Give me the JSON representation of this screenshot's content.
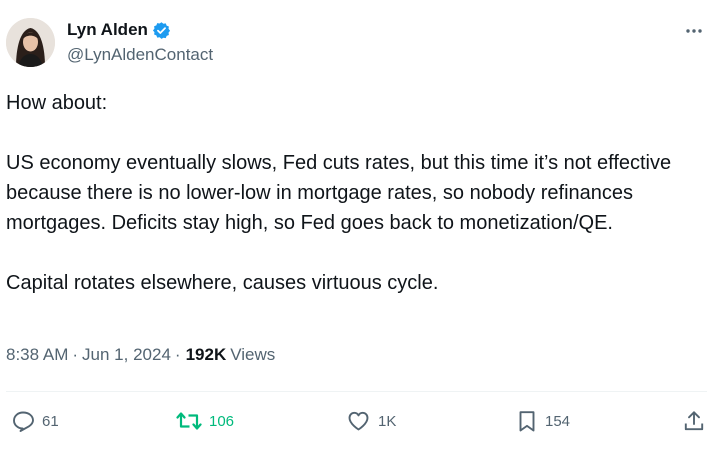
{
  "author": {
    "name": "Lyn Alden",
    "handle": "@LynAldenContact",
    "verified": true,
    "verified_color": "#1d9bf0"
  },
  "tweet": {
    "paragraphs": [
      "How about:",
      "US economy eventually slows, Fed cuts rates, but this time it’s not effective because there is no lower-low in mortgage rates, so nobody refinances mortgages. Deficits stay high, so Fed goes back to monetization/QE.",
      "Capital rotates elsewhere, causes virtuous cycle."
    ],
    "time": "8:38 AM",
    "separator": "·",
    "date": "Jun 1, 2024",
    "views_count": "192K",
    "views_label": "Views"
  },
  "actions": {
    "reply_count": "61",
    "retweet_count": "106",
    "like_count": "1K",
    "bookmark_count": "154"
  },
  "icons": {
    "more": "more-dots-icon",
    "reply": "reply-icon",
    "retweet": "retweet-icon",
    "like": "heart-icon",
    "bookmark": "bookmark-icon",
    "share": "share-icon"
  },
  "colors": {
    "text": "#0f1419",
    "secondary": "#536471",
    "retweet_active": "#00ba7c"
  }
}
